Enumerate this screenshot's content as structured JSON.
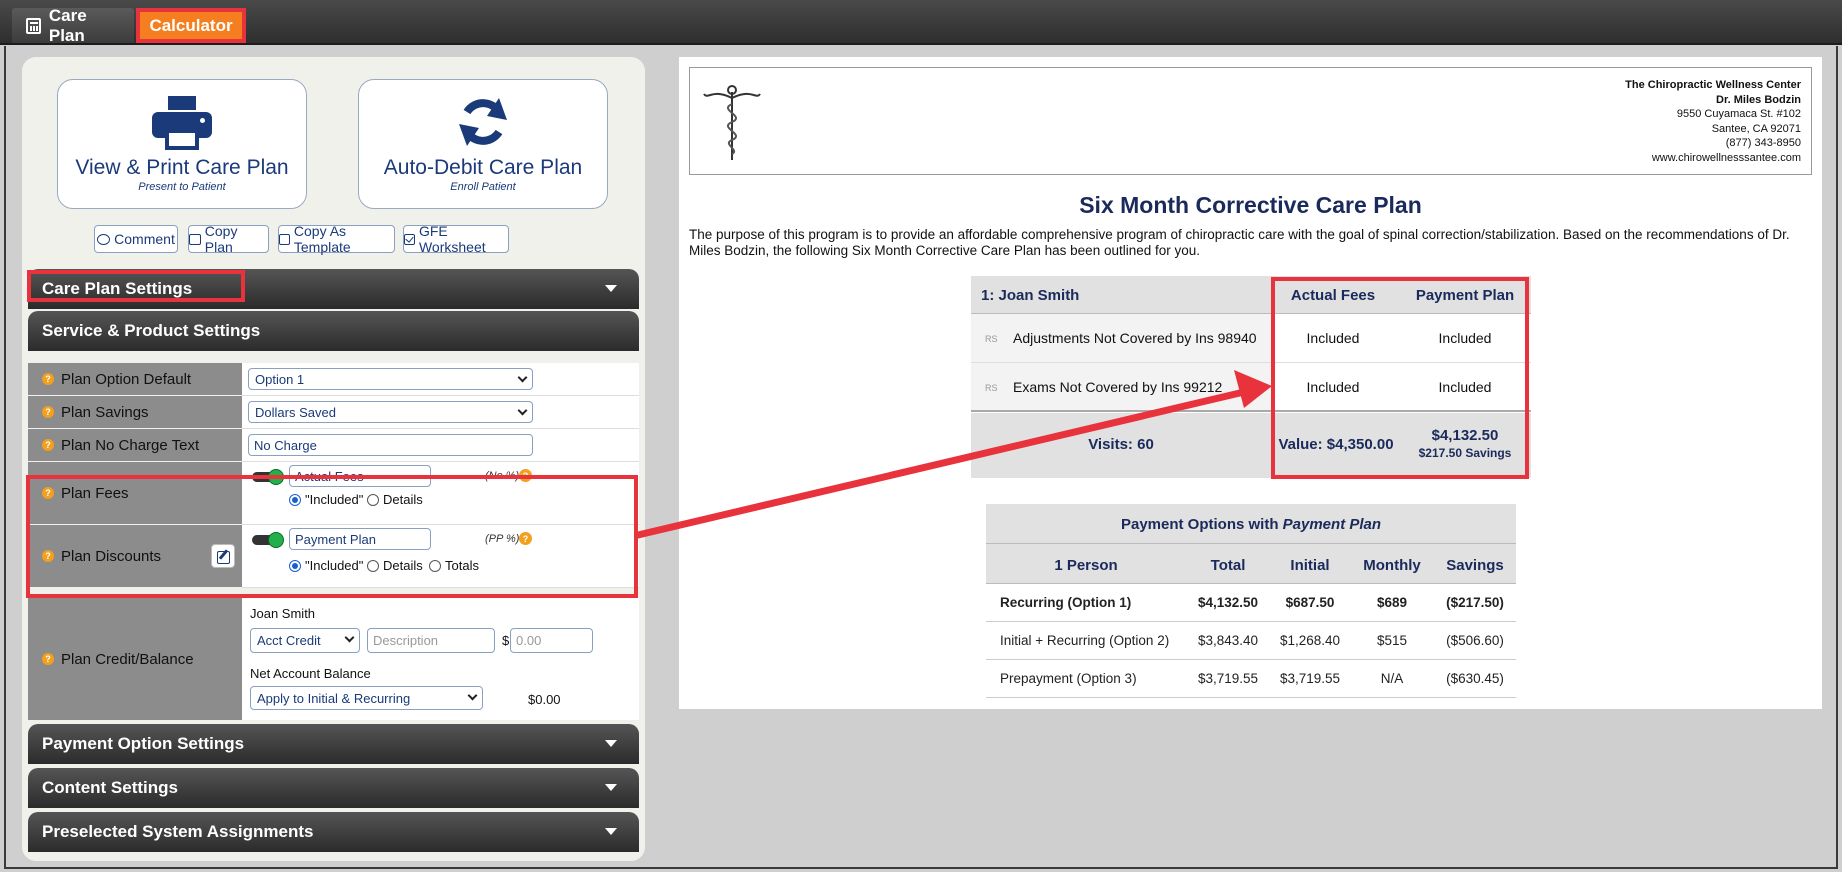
{
  "tabs": {
    "care_plan": "Care Plan",
    "calculator": "Calculator"
  },
  "buttons": {
    "print_title": "View & Print Care Plan",
    "print_sub": "Present to Patient",
    "auto_title": "Auto-Debit Care Plan",
    "auto_sub": "Enroll Patient",
    "comment": "Comment",
    "copy_plan": "Copy Plan",
    "copy_template": "Copy As Template",
    "gfe": "GFE Worksheet"
  },
  "sections": {
    "care_plan_settings": "Care Plan Settings",
    "service_product": "Service & Product Settings",
    "payment_option": "Payment Option Settings",
    "content": "Content Settings",
    "preselected": "Preselected System Assignments"
  },
  "settings": {
    "plan_option_default": {
      "label": "Plan Option Default",
      "value": "Option 1"
    },
    "plan_savings": {
      "label": "Plan Savings",
      "value": "Dollars Saved"
    },
    "plan_no_charge": {
      "label": "Plan No Charge Text",
      "value": "No Charge"
    },
    "plan_fees": {
      "label": "Plan Fees",
      "value": "Actual Fees",
      "pct": "(No %)",
      "opt_included": "\"Included\"",
      "opt_details": "Details"
    },
    "plan_discounts": {
      "label": "Plan Discounts",
      "value": "Payment Plan",
      "pct": "(PP %)",
      "opt_included": "\"Included\"",
      "opt_details": "Details",
      "opt_totals": "Totals"
    },
    "plan_credit": {
      "label": "Plan Credit/Balance",
      "patient": "Joan Smith",
      "credit_type": "Acct Credit",
      "description_ph": "Description",
      "currency": "$",
      "amount_ph": "0.00",
      "net_label": "Net Account Balance",
      "apply": "Apply to Initial & Recurring",
      "net_value": "$0.00"
    }
  },
  "document": {
    "clinic": "The Chiropractic Wellness Center",
    "doctor": "Dr. Miles Bodzin",
    "street": "9550 Cuyamaca St. #102",
    "city": "Santee, CA 92071",
    "phone": "(877) 343-8950",
    "web": "www.chirowellnesssantee.com",
    "title": "Six Month Corrective Care Plan",
    "intro": "The purpose of this program is to provide an affordable comprehensive program of chiropractic care with the goal of spinal correction/stabilization. Based on the recommendations of Dr. Miles Bodzin, the following Six Month Corrective Care Plan has been outlined for you.",
    "plan_header": "1: Joan Smith",
    "col_actual": "Actual Fees",
    "col_payment": "Payment Plan",
    "rows": [
      {
        "tag": "RS",
        "name": "Adjustments Not Covered by Ins 98940",
        "actual": "Included",
        "payment": "Included"
      },
      {
        "tag": "RS",
        "name": "Exams Not Covered by Ins 99212",
        "actual": "Included",
        "payment": "Included"
      }
    ],
    "visits": "Visits: 60",
    "value": "Value: $4,350.00",
    "pp_total": "$4,132.50",
    "pp_savings": "$217.50 Savings",
    "payopts_title_a": "Payment Options with ",
    "payopts_title_b": "Payment Plan",
    "payopts_headers": [
      "1 Person",
      "Total",
      "Initial",
      "Monthly",
      "Savings"
    ],
    "payopts_rows": [
      [
        "Recurring (Option 1)",
        "$4,132.50",
        "$687.50",
        "$689",
        "($217.50)"
      ],
      [
        "Initial + Recurring (Option 2)",
        "$3,843.40",
        "$1,268.40",
        "$515",
        "($506.60)"
      ],
      [
        "Prepayment (Option 3)",
        "$3,719.55",
        "$3,719.55",
        "N/A",
        "($630.45)"
      ]
    ]
  }
}
